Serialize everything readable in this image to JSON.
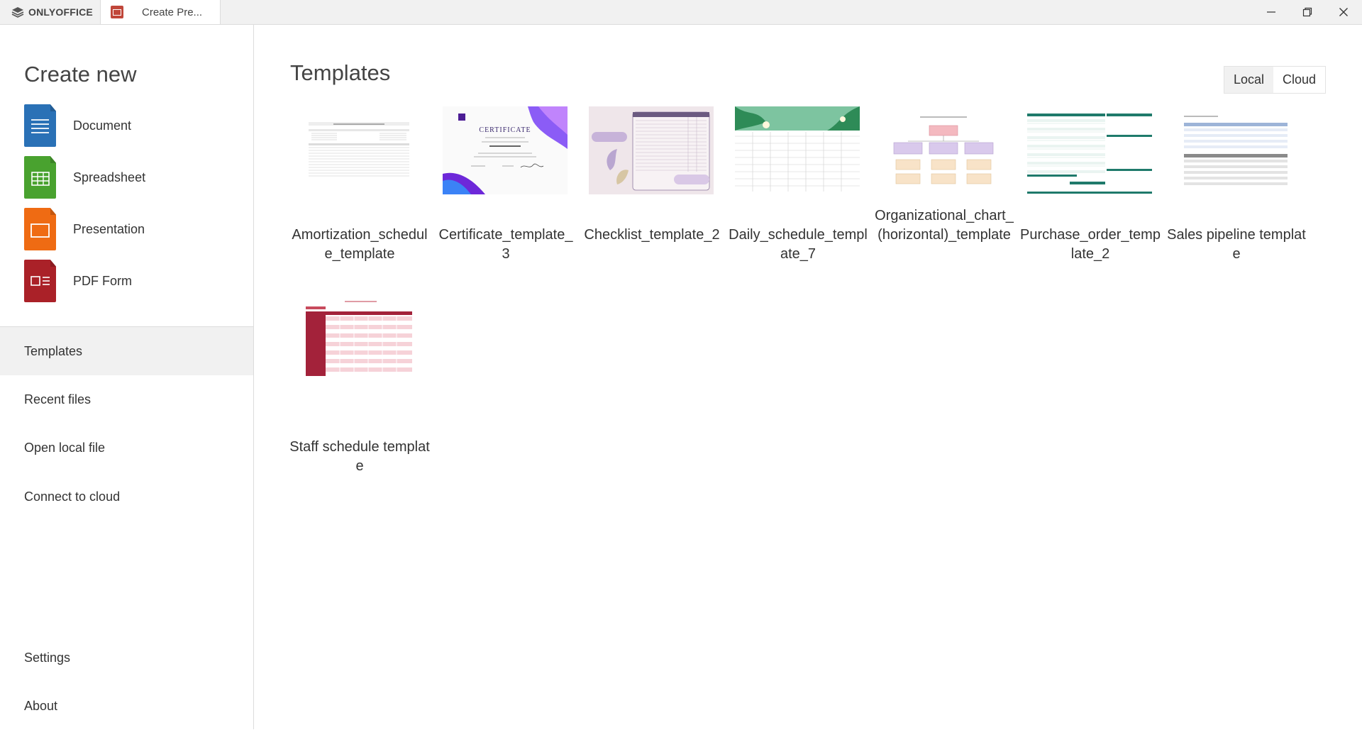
{
  "app": {
    "name": "ONLYOFFICE"
  },
  "tab": {
    "title": "Create Pre..."
  },
  "sidebar": {
    "create_title": "Create new",
    "create_items": [
      {
        "label": "Document",
        "icon": "document-icon",
        "color": "#2a71b6"
      },
      {
        "label": "Spreadsheet",
        "icon": "spreadsheet-icon",
        "color": "#49a22f"
      },
      {
        "label": "Presentation",
        "icon": "presentation-icon",
        "color": "#ef6b13"
      },
      {
        "label": "PDF Form",
        "icon": "pdf-form-icon",
        "color": "#aa2128"
      }
    ],
    "nav_items": [
      {
        "label": "Templates",
        "active": true
      },
      {
        "label": "Recent files"
      },
      {
        "label": "Open local file"
      },
      {
        "label": "Connect to cloud"
      }
    ],
    "bottom_items": [
      {
        "label": "Settings"
      },
      {
        "label": "About"
      }
    ]
  },
  "main": {
    "title": "Templates",
    "toggle": {
      "local": "Local",
      "cloud": "Cloud",
      "active": "Local"
    },
    "templates": [
      {
        "name": "Amortization_schedule_template"
      },
      {
        "name": "Certificate_template_3"
      },
      {
        "name": "Checklist_template_2"
      },
      {
        "name": "Daily_schedule_template_7"
      },
      {
        "name": "Organizational_chart_(horizontal)_template"
      },
      {
        "name": "Purchase_order_template_2"
      },
      {
        "name": "Sales pipeline template"
      },
      {
        "name": "Staff schedule template"
      }
    ]
  }
}
